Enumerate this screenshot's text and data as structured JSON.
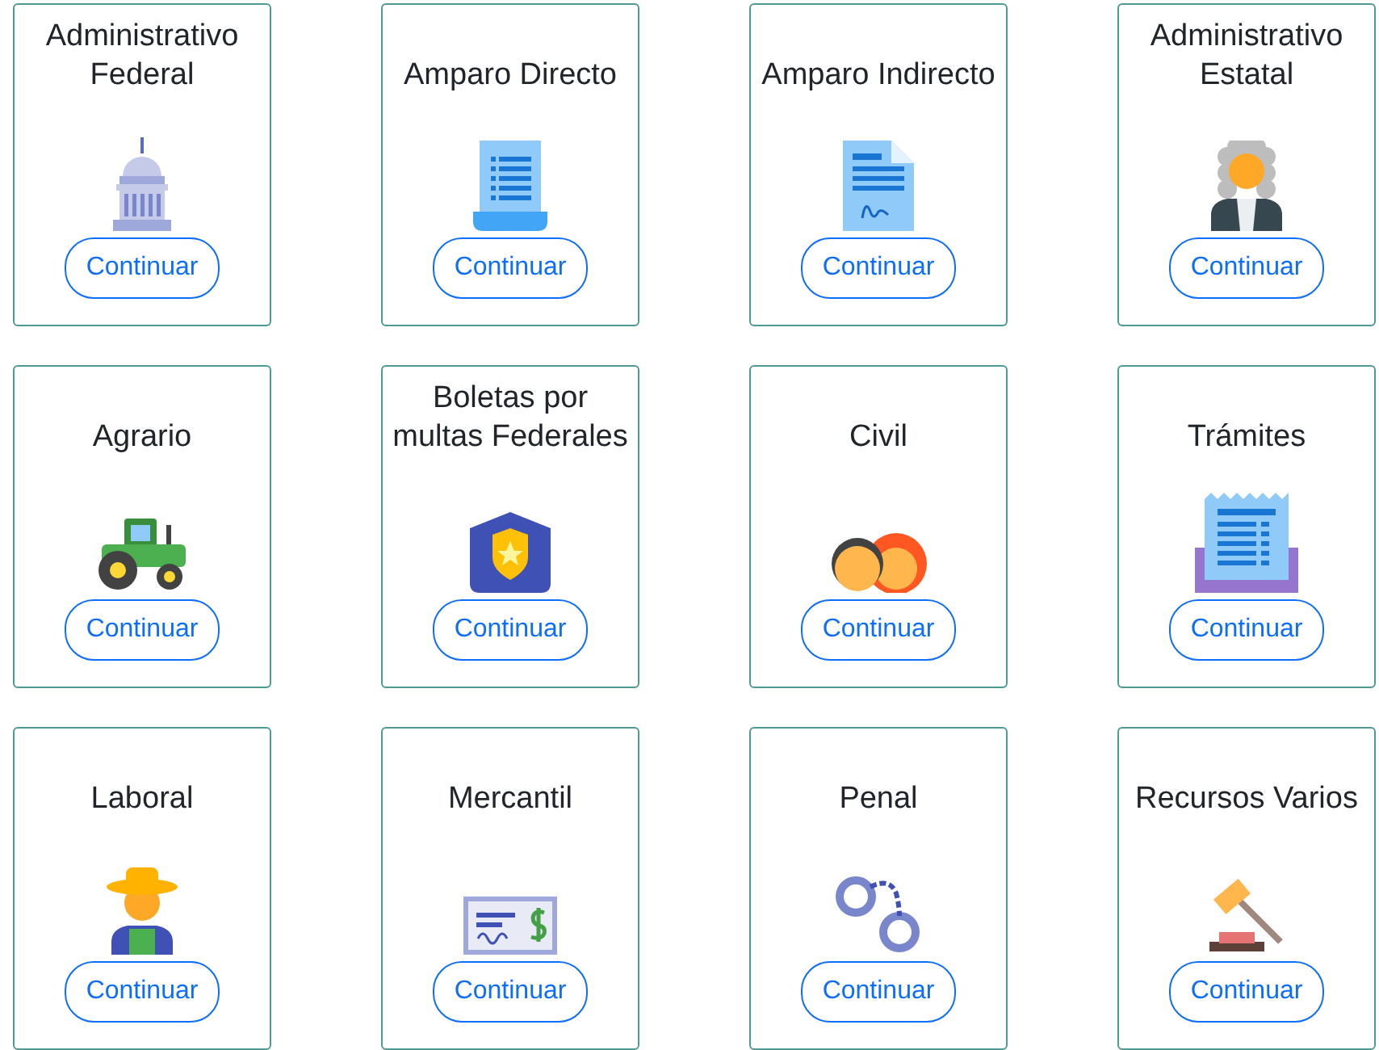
{
  "cards": [
    {
      "title": "Administrativo Federal",
      "kind": "capitol",
      "button": "Continuar"
    },
    {
      "title": "Amparo Directo",
      "kind": "scroll",
      "button": "Continuar"
    },
    {
      "title": "Amparo Indirecto",
      "kind": "signed",
      "button": "Continuar"
    },
    {
      "title": "Administrativo Estatal",
      "kind": "judge",
      "button": "Continuar"
    },
    {
      "title": "Agrario",
      "kind": "tractor",
      "button": "Continuar"
    },
    {
      "title": "Boletas por multas Federales",
      "kind": "badge",
      "button": "Continuar"
    },
    {
      "title": "Civil",
      "kind": "people",
      "button": "Continuar"
    },
    {
      "title": "Trámites",
      "kind": "receipt",
      "button": "Continuar"
    },
    {
      "title": "Laboral",
      "kind": "farmer",
      "button": "Continuar"
    },
    {
      "title": "Mercantil",
      "kind": "check",
      "button": "Continuar"
    },
    {
      "title": "Penal",
      "kind": "handcuffs",
      "button": "Continuar"
    },
    {
      "title": "Recursos Varios",
      "kind": "gavel",
      "button": "Continuar"
    }
  ]
}
